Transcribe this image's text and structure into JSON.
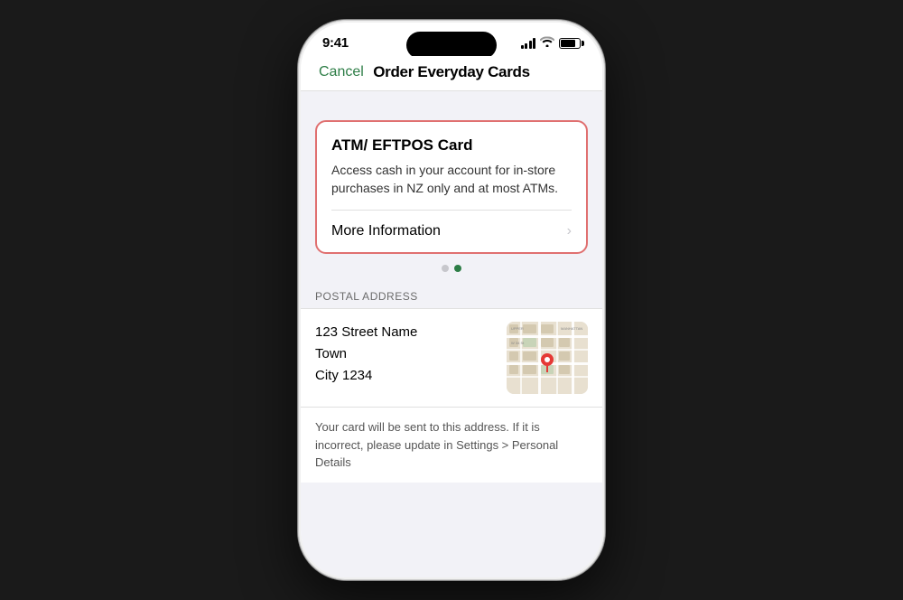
{
  "statusBar": {
    "time": "9:41"
  },
  "navBar": {
    "cancelLabel": "Cancel",
    "title": "Order Everyday Cards"
  },
  "cardSection": {
    "title": "ATM/ EFTPOS Card",
    "description": "Access cash in your account for in-store purchases in NZ only and at most ATMs.",
    "moreInfoLabel": "More Information"
  },
  "dots": {
    "count": 2,
    "activeIndex": 1
  },
  "postalAddress": {
    "sectionHeader": "POSTAL ADDRESS",
    "line1": "123 Street Name",
    "line2": "Town",
    "line3": "City 1234"
  },
  "bottomNote": {
    "text": "Your card will be sent to this address. If it is incorrect, please update in Settings > Personal Details"
  }
}
